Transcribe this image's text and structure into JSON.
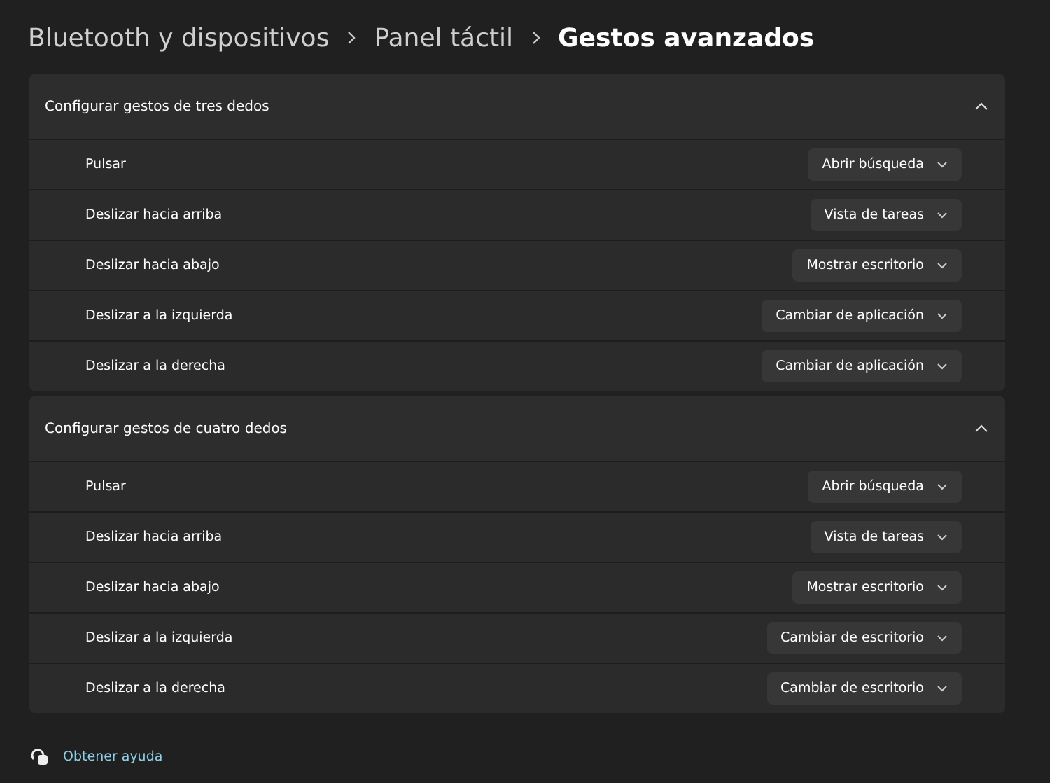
{
  "breadcrumb": [
    {
      "label": "Bluetooth y dispositivos",
      "current": false
    },
    {
      "label": "Panel táctil",
      "current": false
    },
    {
      "label": "Gestos avanzados",
      "current": true
    }
  ],
  "sections": [
    {
      "title": "Configurar gestos de tres dedos",
      "expanded": true,
      "rows": [
        {
          "label": "Pulsar",
          "value": "Abrir búsqueda"
        },
        {
          "label": "Deslizar hacia arriba",
          "value": "Vista de tareas"
        },
        {
          "label": "Deslizar hacia abajo",
          "value": "Mostrar escritorio"
        },
        {
          "label": "Deslizar a la izquierda",
          "value": "Cambiar de aplicación"
        },
        {
          "label": "Deslizar a la derecha",
          "value": "Cambiar de aplicación"
        }
      ]
    },
    {
      "title": "Configurar gestos de cuatro dedos",
      "expanded": true,
      "rows": [
        {
          "label": "Pulsar",
          "value": "Abrir búsqueda"
        },
        {
          "label": "Deslizar hacia arriba",
          "value": "Vista de tareas"
        },
        {
          "label": "Deslizar hacia abajo",
          "value": "Mostrar escritorio"
        },
        {
          "label": "Deslizar a la izquierda",
          "value": "Cambiar de escritorio"
        },
        {
          "label": "Deslizar a la derecha",
          "value": "Cambiar de escritorio"
        }
      ]
    }
  ],
  "help_link": "Obtener ayuda"
}
